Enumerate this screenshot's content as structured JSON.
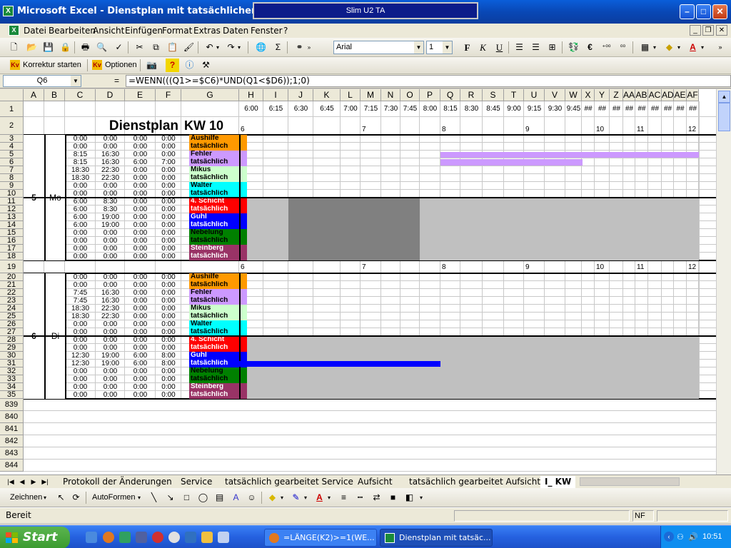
{
  "window": {
    "title": "Microsoft Excel - Dienstplan mit tatsächlicher A-Zeit1",
    "tooltip": "Slim U2 TA"
  },
  "menu": [
    "Datei",
    "Bearbeiten",
    "Ansicht",
    "Einfügen",
    "Format",
    "Extras",
    "Daten",
    "Fenster",
    "?"
  ],
  "toolbar": {
    "font": "Arial",
    "size": "1"
  },
  "toolbar2": {
    "korrektur": "Korrektur starten",
    "optionen": "Optionen"
  },
  "formula_bar": {
    "name_box": "Q6",
    "equals": "=",
    "formula": "=WENN(((Q1>=$C6)*UND(Q1<$D6));1;0)"
  },
  "columns": [
    "A",
    "B",
    "C",
    "D",
    "E",
    "F",
    "G",
    "H",
    "I",
    "J",
    "K",
    "L",
    "M",
    "N",
    "O",
    "P",
    "Q",
    "R",
    "S",
    "T",
    "U",
    "V",
    "W",
    "X",
    "Y",
    "Z",
    "AA",
    "AB",
    "AC",
    "AD",
    "AE",
    "AF"
  ],
  "time_header": [
    "6:00",
    "6:15",
    "6:30",
    "6:45",
    "7:00",
    "7:15",
    "7:30",
    "7:45",
    "8:00",
    "8:15",
    "8:30",
    "8:45",
    "9:00",
    "9:15",
    "9:30",
    "9:45",
    "##",
    "##",
    "##",
    "##",
    "##",
    "##",
    "##",
    "##",
    "##"
  ],
  "sheet_title": "Dienstplan",
  "week_label": "KW  10",
  "hour_ticks": [
    "6",
    "7",
    "8",
    "9",
    "10",
    "11",
    "12"
  ],
  "persons": [
    "Aushilfe",
    "tatsächlich",
    "Fehler",
    "tatsächlich",
    "Mikus",
    "tatsächlich",
    "Walter",
    "tatsächlich",
    "4. Schicht",
    "tatsächlich",
    "Guhl",
    "tatsächlich",
    "Nebelung",
    "tatsächlich",
    "Steinberg",
    "tatsächlich"
  ],
  "person_colors": [
    "#ff9900",
    "#ff9900",
    "#cc99ff",
    "#cc99ff",
    "#ccffcc",
    "#ccffcc",
    "#00ffff",
    "#00ffff",
    "#ff0000",
    "#ff0000",
    "#0000ff",
    "#0000ff",
    "#008000",
    "#008000",
    "#993366",
    "#993366"
  ],
  "day1": {
    "num": "5",
    "day": "Mo",
    "row_numbers": [
      "3",
      "4",
      "5",
      "6",
      "7",
      "8",
      "9",
      "10",
      "11",
      "12",
      "13",
      "14",
      "15",
      "16",
      "17",
      "18"
    ],
    "rows": [
      [
        "0:00",
        "0:00",
        "0:00",
        "0:00"
      ],
      [
        "0:00",
        "0:00",
        "0:00",
        "0:00"
      ],
      [
        "8:15",
        "16:30",
        "0:00",
        "0:00"
      ],
      [
        "8:15",
        "16:30",
        "6:00",
        "7:00"
      ],
      [
        "18:30",
        "22:30",
        "0:00",
        "0:00"
      ],
      [
        "18:30",
        "22:30",
        "0:00",
        "0:00"
      ],
      [
        "0:00",
        "0:00",
        "0:00",
        "0:00"
      ],
      [
        "0:00",
        "0:00",
        "0:00",
        "0:00"
      ],
      [
        "6:00",
        "8:30",
        "0:00",
        "0:00"
      ],
      [
        "6:00",
        "8:30",
        "0:00",
        "0:00"
      ],
      [
        "6:00",
        "19:00",
        "0:00",
        "0:00"
      ],
      [
        "6:00",
        "19:00",
        "0:00",
        "0:00"
      ],
      [
        "0:00",
        "0:00",
        "0:00",
        "0:00"
      ],
      [
        "0:00",
        "0:00",
        "0:00",
        "0:00"
      ],
      [
        "0:00",
        "0:00",
        "0:00",
        "0:00"
      ],
      [
        "0:00",
        "0:00",
        "0:00",
        "0:00"
      ]
    ]
  },
  "day2": {
    "num": "6",
    "day": "Di",
    "row_numbers": [
      "20",
      "21",
      "22",
      "23",
      "24",
      "25",
      "26",
      "27",
      "28",
      "29",
      "30",
      "31",
      "32",
      "33",
      "34",
      "35"
    ],
    "rows": [
      [
        "0:00",
        "0:00",
        "0:00",
        "0:00"
      ],
      [
        "0:00",
        "0:00",
        "0:00",
        "0:00"
      ],
      [
        "7:45",
        "16:30",
        "0:00",
        "0:00"
      ],
      [
        "7:45",
        "16:30",
        "0:00",
        "0:00"
      ],
      [
        "18:30",
        "22:30",
        "0:00",
        "0:00"
      ],
      [
        "18:30",
        "22:30",
        "0:00",
        "0:00"
      ],
      [
        "0:00",
        "0:00",
        "0:00",
        "0:00"
      ],
      [
        "0:00",
        "0:00",
        "0:00",
        "0:00"
      ],
      [
        "0:00",
        "0:00",
        "0:00",
        "0:00"
      ],
      [
        "0:00",
        "0:00",
        "0:00",
        "0:00"
      ],
      [
        "12:30",
        "19:00",
        "6:00",
        "8:00"
      ],
      [
        "12:30",
        "19:00",
        "6:00",
        "8:00"
      ],
      [
        "0:00",
        "0:00",
        "0:00",
        "0:00"
      ],
      [
        "0:00",
        "0:00",
        "0:00",
        "0:00"
      ],
      [
        "0:00",
        "0:00",
        "0:00",
        "0:00"
      ],
      [
        "0:00",
        "0:00",
        "0:00",
        "0:00"
      ]
    ]
  },
  "row_headers": {
    "r1": "1",
    "r2": "2",
    "r19": "19"
  },
  "extra_rows": [
    "839",
    "840",
    "841",
    "842",
    "843",
    "844"
  ],
  "sheet_tabs": [
    "Protokoll der Änderungen",
    "Service",
    "tatsächlich gearbeitet Service",
    "Aufsicht",
    "tatsächlich gearbeitet Aufsicht",
    "I_ KW"
  ],
  "drawbar": {
    "zeichnen": "Zeichnen",
    "autoformen": "AutoFormen"
  },
  "status": {
    "text": "Bereit",
    "nf": "NF"
  },
  "taskbar": {
    "start": "Start",
    "tasks": [
      "=LÄNGE(K2)>=1(WE...",
      "Dienstplan mit tatsäc..."
    ],
    "clock": "10:51"
  },
  "colors": {
    "title_blue": "#0a5ed9",
    "grey_fill": "#c0c0c0",
    "dark_grey": "#808080",
    "lilac": "#cc99ff",
    "blue": "#0000ff"
  }
}
